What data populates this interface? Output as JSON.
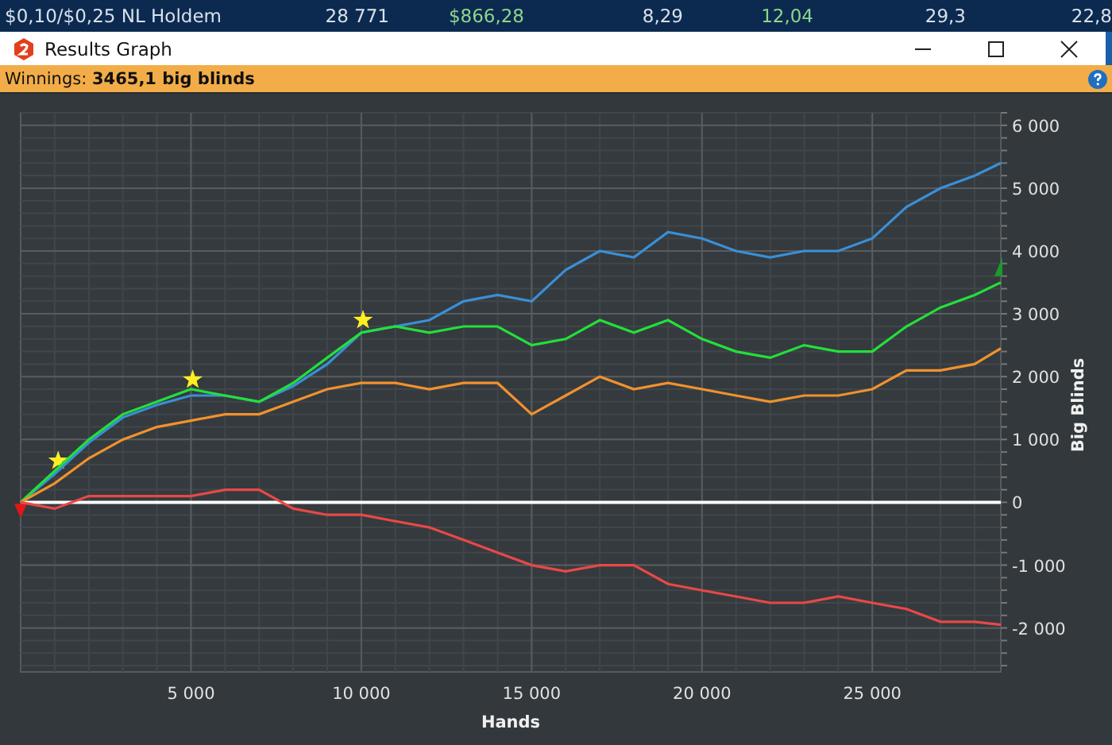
{
  "stats_row": [
    {
      "text": "$0,10/$0,25 NL Holdem",
      "positive": false
    },
    {
      "text": "28 771",
      "positive": false
    },
    {
      "text": "$866,28",
      "positive": true
    },
    {
      "text": "8,29",
      "positive": false
    },
    {
      "text": "12,04",
      "positive": true
    },
    {
      "text": "29,3",
      "positive": false
    },
    {
      "text": "22,8",
      "positive": false
    }
  ],
  "window": {
    "title": "Results Graph"
  },
  "info_bar": {
    "text": "Winnings: **3465,1 big blinds**"
  },
  "chart_data": {
    "type": "line",
    "xlabel": "Hands",
    "ylabel": "Big Blinds",
    "x": [
      0,
      1000,
      2000,
      3000,
      4000,
      5000,
      6000,
      7000,
      8000,
      9000,
      10000,
      11000,
      12000,
      13000,
      14000,
      15000,
      16000,
      17000,
      18000,
      19000,
      20000,
      21000,
      22000,
      23000,
      24000,
      25000,
      26000,
      27000,
      28000,
      28771
    ],
    "series": [
      {
        "color": "#3a8fd6",
        "values": [
          0,
          450,
          950,
          1350,
          1550,
          1700,
          1700,
          1600,
          1850,
          2200,
          2700,
          2800,
          2900,
          3200,
          3300,
          3200,
          3700,
          4000,
          3900,
          4300,
          4200,
          4000,
          3900,
          4000,
          4000,
          4200,
          4700,
          5000,
          5200,
          5400
        ]
      },
      {
        "color": "#22e03a",
        "values": [
          0,
          500,
          1000,
          1400,
          1600,
          1800,
          1700,
          1600,
          1900,
          2300,
          2700,
          2800,
          2700,
          2800,
          2800,
          2500,
          2600,
          2900,
          2700,
          2900,
          2600,
          2400,
          2300,
          2500,
          2400,
          2400,
          2800,
          3100,
          3300,
          3500
        ]
      },
      {
        "color": "#f0922e",
        "values": [
          0,
          300,
          700,
          1000,
          1200,
          1300,
          1400,
          1400,
          1600,
          1800,
          1900,
          1900,
          1800,
          1900,
          1900,
          1400,
          1700,
          2000,
          1800,
          1900,
          1800,
          1700,
          1600,
          1700,
          1700,
          1800,
          2100,
          2100,
          2200,
          2450
        ]
      },
      {
        "color": "#e84848",
        "values": [
          0,
          -100,
          100,
          100,
          100,
          100,
          200,
          200,
          -100,
          -200,
          -200,
          -300,
          -400,
          -600,
          -800,
          -1000,
          -1100,
          -1000,
          -1000,
          -1300,
          -1400,
          -1500,
          -1600,
          -1600,
          -1500,
          -1600,
          -1700,
          -1900,
          -1900,
          -1950
        ]
      }
    ],
    "xlim": [
      0,
      28771
    ],
    "ylim": [
      -2700,
      6200
    ],
    "grid": true,
    "xticks": [
      {
        "value": 5000,
        "label": "5 000"
      },
      {
        "value": 10000,
        "label": "10 000"
      },
      {
        "value": 15000,
        "label": "15 000"
      },
      {
        "value": 20000,
        "label": "20 000"
      },
      {
        "value": 25000,
        "label": "25 000"
      }
    ],
    "yticks": [
      {
        "value": 6000,
        "label": "6 000"
      },
      {
        "value": 5000,
        "label": "5 000"
      },
      {
        "value": 4000,
        "label": "4 000"
      },
      {
        "value": 3000,
        "label": "3 000"
      },
      {
        "value": 2000,
        "label": "2 000"
      },
      {
        "value": 1000,
        "label": "1 000"
      },
      {
        "value": 0,
        "label": "0"
      },
      {
        "value": -1000,
        "label": "-1 000"
      },
      {
        "value": -2000,
        "label": "-2 000"
      }
    ]
  },
  "markers": [
    {
      "kind": "star"
    },
    {
      "kind": "star"
    },
    {
      "kind": "star"
    },
    {
      "kind": "triangle-down"
    },
    {
      "kind": "triangle-up"
    }
  ]
}
